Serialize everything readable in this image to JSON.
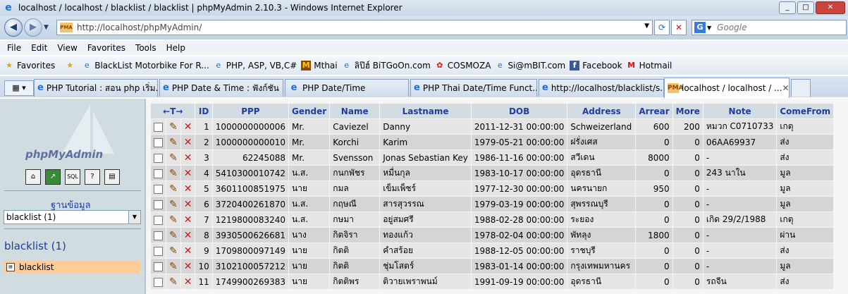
{
  "window": {
    "title": "localhost / localhost / blacklist / blacklist | phpMyAdmin 2.10.3 - Windows Internet Explorer"
  },
  "address": {
    "url": "http://localhost/phpMyAdmin/",
    "search_placeholder": "Google"
  },
  "menu": [
    "File",
    "Edit",
    "View",
    "Favorites",
    "Tools",
    "Help"
  ],
  "favorites": {
    "label": "Favorites",
    "items": [
      "BlackList Motorbike For R...",
      "PHP, ASP, VB,C#",
      "Mthai",
      "ลิป๊ฮ์ BiTGoOn.com",
      "COSMOZA",
      "Si@mBIT.com",
      "Facebook",
      "Hotmail"
    ]
  },
  "tabs": [
    {
      "label": "PHP Tutorial : สอน php เริ่ม..."
    },
    {
      "label": "PHP Date & Time : ฟังก์ชัน ..."
    },
    {
      "label": "PHP Date/Time"
    },
    {
      "label": "PHP Thai Date/Time Funct..."
    },
    {
      "label": "http://localhost/blacklist/s..."
    },
    {
      "label": "localhost / localhost / ..."
    }
  ],
  "sidebar": {
    "logo_text": "phpMyAdmin",
    "db_label": "ฐานข้อมูล",
    "db_selected": "blacklist (1)",
    "db_title": "blacklist (1)",
    "table_item": "blacklist"
  },
  "table": {
    "headers": {
      "arrows": "←T→",
      "id": "ID",
      "ppp": "PPP",
      "gender": "Gender",
      "name": "Name",
      "lastname": "Lastname",
      "dob": "DOB",
      "address": "Address",
      "arrear": "Arrear",
      "more": "More",
      "note": "Note",
      "comefrom": "ComeFrom"
    },
    "rows": [
      {
        "id": "1",
        "ppp": "1000000000006",
        "gender": "Mr.",
        "name": "Caviezel",
        "lastname": "Danny",
        "dob": "2011-12-31 00:00:00",
        "address": "Schweizerland",
        "arrear": "600",
        "more": "200",
        "note": "หมวก C0710733",
        "comefrom": "เกตุ"
      },
      {
        "id": "2",
        "ppp": "1000000000010",
        "gender": "Mr.",
        "name": "Korchi",
        "lastname": "Karim",
        "dob": "1979-05-21 00:00:00",
        "address": "ฝรั่งเศส",
        "arrear": "0",
        "more": "0",
        "note": "06AA69937",
        "comefrom": "ส่ง"
      },
      {
        "id": "3",
        "ppp": "62245088",
        "gender": "Mr.",
        "name": "Svensson",
        "lastname": "Jonas Sebastian Key",
        "dob": "1986-11-16 00:00:00",
        "address": "สวีเดน",
        "arrear": "8000",
        "more": "0",
        "note": "-",
        "comefrom": "ส่ง"
      },
      {
        "id": "4",
        "ppp": "5410300010742",
        "gender": "น.ส.",
        "name": "กนกพัชร",
        "lastname": "หมื่นกุล",
        "dob": "1983-10-17 00:00:00",
        "address": "อุดรธานี",
        "arrear": "0",
        "more": "0",
        "note": "243 นาใน",
        "comefrom": "มูล"
      },
      {
        "id": "5",
        "ppp": "3601100851975",
        "gender": "นาย",
        "name": "กมล",
        "lastname": "เข็มเพ็ชร์",
        "dob": "1977-12-30 00:00:00",
        "address": "นครนายก",
        "arrear": "950",
        "more": "0",
        "note": "-",
        "comefrom": "มูล"
      },
      {
        "id": "6",
        "ppp": "3720400261870",
        "gender": "น.ส.",
        "name": "กฤษณี",
        "lastname": "สารสุวรรณ",
        "dob": "1979-03-19 00:00:00",
        "address": "สุพรรณบุรี",
        "arrear": "0",
        "more": "0",
        "note": "-",
        "comefrom": "มูล"
      },
      {
        "id": "7",
        "ppp": "1219800083240",
        "gender": "น.ส.",
        "name": "กษมา",
        "lastname": "อยู่สมศรี",
        "dob": "1988-02-28 00:00:00",
        "address": "ระยอง",
        "arrear": "0",
        "more": "0",
        "note": "เกิด 29/2/1988",
        "comefrom": "เกตุ"
      },
      {
        "id": "8",
        "ppp": "3930500626681",
        "gender": "นาง",
        "name": "กิตจิรา",
        "lastname": "ทองแก้ว",
        "dob": "1978-02-04 00:00:00",
        "address": "พัทลุง",
        "arrear": "1800",
        "more": "0",
        "note": "-",
        "comefrom": "ผ่าน"
      },
      {
        "id": "9",
        "ppp": "1709800097149",
        "gender": "นาย",
        "name": "กิตติ",
        "lastname": "คำสร้อย",
        "dob": "1988-12-05 00:00:00",
        "address": "ราชบุรี",
        "arrear": "0",
        "more": "0",
        "note": "-",
        "comefrom": "ส่ง"
      },
      {
        "id": "10",
        "ppp": "3102100057212",
        "gender": "นาย",
        "name": "กิตติ",
        "lastname": "ชุ่มโสตร์",
        "dob": "1983-01-14 00:00:00",
        "address": "กรุงเทพมหานคร",
        "arrear": "0",
        "more": "0",
        "note": "-",
        "comefrom": "มูล"
      },
      {
        "id": "11",
        "ppp": "1749900269383",
        "gender": "นาย",
        "name": "กิตติพร",
        "lastname": "ติวายเพราพนม์",
        "dob": "1991-09-19 00:00:00",
        "address": "อุดรธานี",
        "arrear": "0",
        "more": "0",
        "note": "รถจีน",
        "comefrom": "ส่ง"
      }
    ]
  },
  "colors": {
    "header_bg": "#d3dce3",
    "header_text": "#1e3da0",
    "row_odd": "#e5e5e5",
    "row_even": "#d5d5d5",
    "left_pane": "#d0dce0",
    "selected_table": "#ffcc99"
  }
}
